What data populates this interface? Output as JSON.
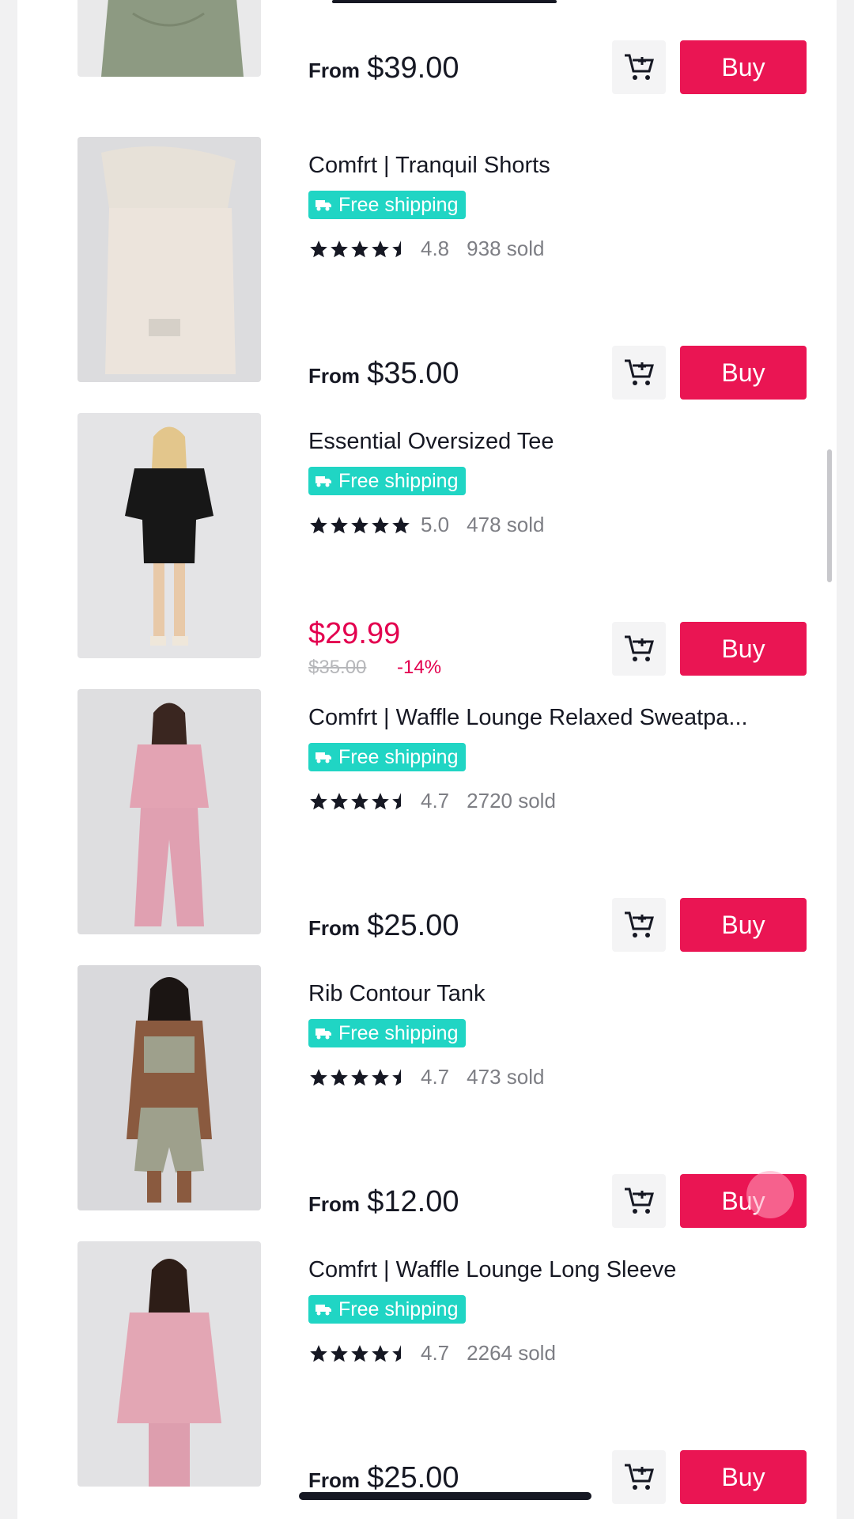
{
  "colors": {
    "buy": "#ea1553",
    "shipping": "#20d5c4",
    "sale": "#e3004f"
  },
  "labels": {
    "from": "From",
    "buy": "Buy",
    "free_shipping": "Free shipping"
  },
  "products": [
    {
      "title": "",
      "rating": null,
      "rating_text": "",
      "sold": "",
      "price_from": "$39.00",
      "sale_price": "",
      "original_price": "",
      "discount": ""
    },
    {
      "title": "Comfrt | Tranquil Shorts",
      "rating": 4.8,
      "rating_text": "4.8",
      "sold": "938 sold",
      "price_from": "$35.00",
      "sale_price": "",
      "original_price": "",
      "discount": ""
    },
    {
      "title": "Essential Oversized Tee",
      "rating": 5.0,
      "rating_text": "5.0",
      "sold": "478 sold",
      "price_from": "",
      "sale_price": "$29.99",
      "original_price": "$35.00",
      "discount": "-14%"
    },
    {
      "title": "Comfrt | Waffle Lounge Relaxed Sweatpa...",
      "rating": 4.7,
      "rating_text": "4.7",
      "sold": "2720 sold",
      "price_from": "$25.00",
      "sale_price": "",
      "original_price": "",
      "discount": ""
    },
    {
      "title": "Rib Contour Tank",
      "rating": 4.7,
      "rating_text": "4.7",
      "sold": "473 sold",
      "price_from": "$12.00",
      "sale_price": "",
      "original_price": "",
      "discount": ""
    },
    {
      "title": "Comfrt | Waffle Lounge Long Sleeve",
      "rating": 4.7,
      "rating_text": "4.7",
      "sold": "2264 sold",
      "price_from": "$25.00",
      "sale_price": "",
      "original_price": "",
      "discount": ""
    }
  ],
  "icons": {
    "cart": "add-to-cart-icon",
    "star": "star-icon",
    "truck": "truck-icon"
  }
}
